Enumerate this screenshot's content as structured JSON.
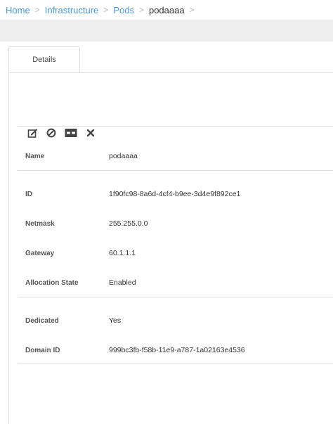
{
  "breadcrumb": {
    "items": [
      "Home",
      "Infrastructure",
      "Pods"
    ],
    "separator": ">",
    "current": "podaaaa",
    "trailing_separator": ">"
  },
  "tabs": [
    {
      "label": "Details",
      "active": true
    }
  ],
  "actions": [
    {
      "name": "edit-icon",
      "glyph": "✎"
    },
    {
      "name": "disable-icon",
      "glyph": "⊘"
    },
    {
      "name": "dedicate-icon",
      "glyph": "▣"
    },
    {
      "name": "delete-icon",
      "glyph": "✖"
    }
  ],
  "details": [
    {
      "label": "Name",
      "value": "podaaaa"
    },
    {
      "label": "ID",
      "value": "1f90fc98-8a6d-4cf4-b9ee-3d4e9f892ce1"
    },
    {
      "label": "Netmask",
      "value": "255.255.0.0"
    },
    {
      "label": "Gateway",
      "value": "60.1.1.1"
    },
    {
      "label": "Allocation State",
      "value": "Enabled"
    },
    {
      "label": "Dedicated",
      "value": "Yes"
    },
    {
      "label": "Domain ID",
      "value": "999bc3fb-f58b-11e9-a787-1a02163e4536"
    }
  ],
  "colors": {
    "link": "#4a9bd6",
    "band": "#efefef",
    "border": "#dddddd"
  }
}
